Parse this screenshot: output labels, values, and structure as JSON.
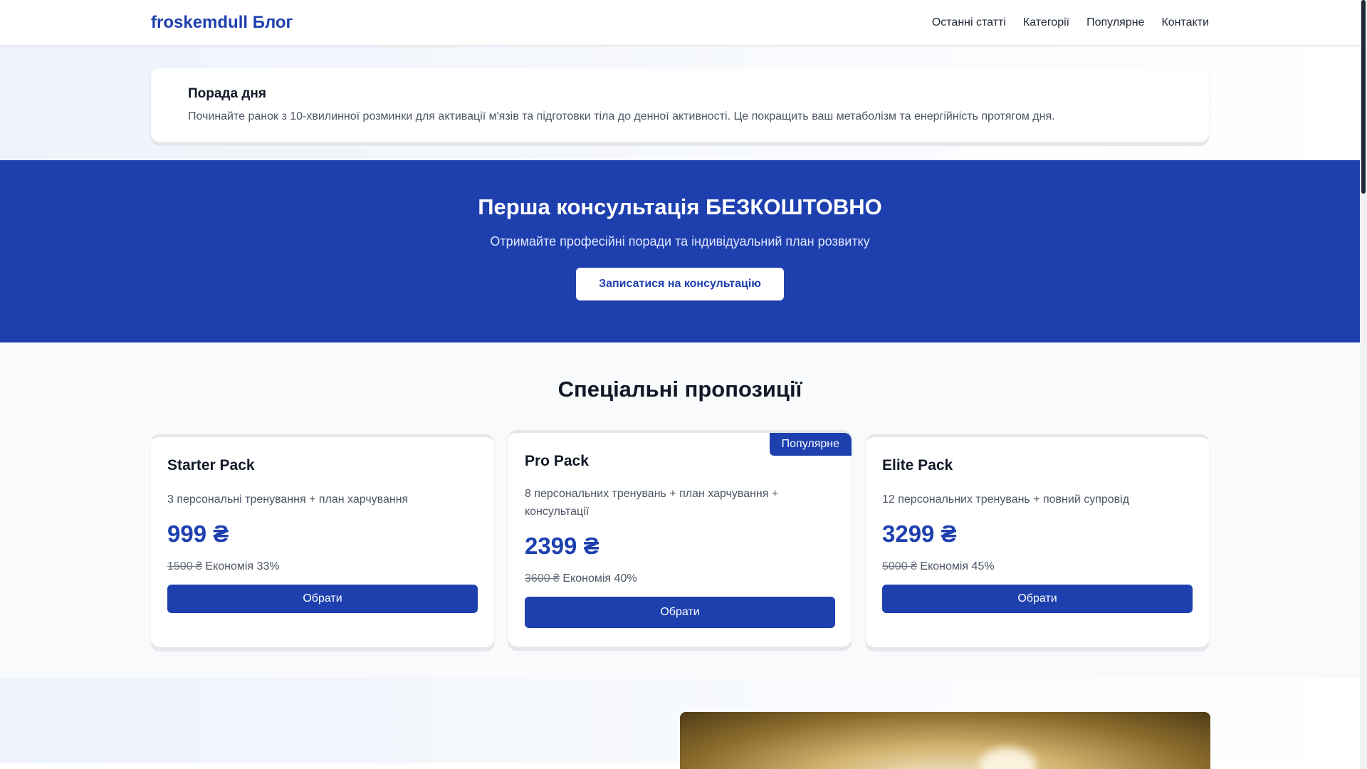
{
  "header": {
    "logo": "froskemdull Блог",
    "nav": [
      "Останні статті",
      "Категорії",
      "Популярне",
      "Контакти"
    ]
  },
  "tip": {
    "title": "Порада дня",
    "text": "Починайте ранок з 10-хвилинної розминки для активації м'язів та підготовки тіла до денної активності. Це покращить ваш метаболізм та енергійність протягом дня."
  },
  "banner": {
    "title": "Перша консультація БЕЗКОШТОВНО",
    "subtitle": "Отримайте професійні поради та індивідуальний план розвитку",
    "button": "Записатися на консультацію"
  },
  "offers": {
    "title": "Спеціальні пропозиції",
    "cards": [
      {
        "title": "Starter Pack",
        "desc": "3 персональні тренування + план харчування",
        "price": "999 ₴",
        "old_price": "1500 ₴",
        "savings": "Економія 33%",
        "button": "Обрати"
      },
      {
        "title": "Pro Pack",
        "badge": "Популярне",
        "desc": "8 персональних тренувань + план харчування + консультації",
        "price": "2399 ₴",
        "old_price": "3600 ₴",
        "savings": "Економія 40%",
        "button": "Обрати"
      },
      {
        "title": "Elite Pack",
        "desc": "12 персональних тренувань + повний супровід",
        "price": "3299 ₴",
        "old_price": "5000 ₴",
        "savings": "Економія 45%",
        "button": "Обрати"
      }
    ]
  },
  "colors": {
    "brand": "#1e40af",
    "text": "#111827",
    "muted": "#4b5563"
  }
}
